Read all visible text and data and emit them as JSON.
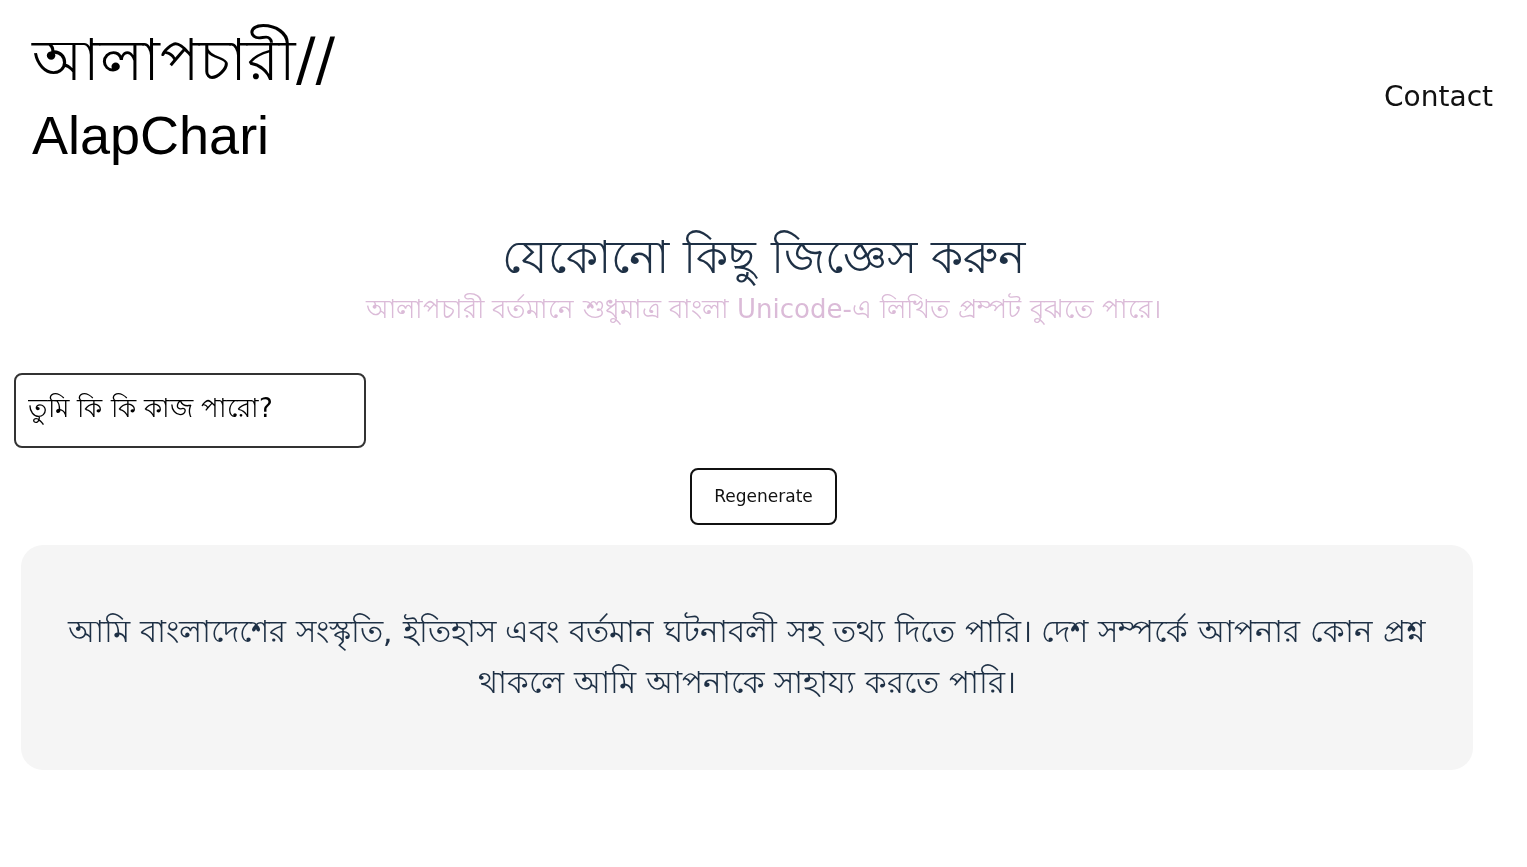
{
  "logo": {
    "bengali": "আলাপচারী//",
    "latin": "AlapChari"
  },
  "nav": [
    {
      "label": "Contact"
    }
  ],
  "heading": "যেকোনো কিছু জিজ্ঞেস করুন",
  "subtitle": "আলাপচারী বর্তমানে শুধুমাত্র বাংলা Unicode-এ লিখিত প্রম্পট বুঝতে পারে।",
  "prompt": {
    "value": "তুমি কি কি কাজ পারো?"
  },
  "button": "Regenerate",
  "answer": "আমি বাংলাদেশের সংস্কৃতি, ইতিহাস এবং বর্তমান ঘটনাবলী সহ তথ্য দিতে পারি। দেশ সম্পর্কে আপনার কোন প্রশ্ন থাকলে আমি আপনাকে সাহায্য করতে পারি।"
}
